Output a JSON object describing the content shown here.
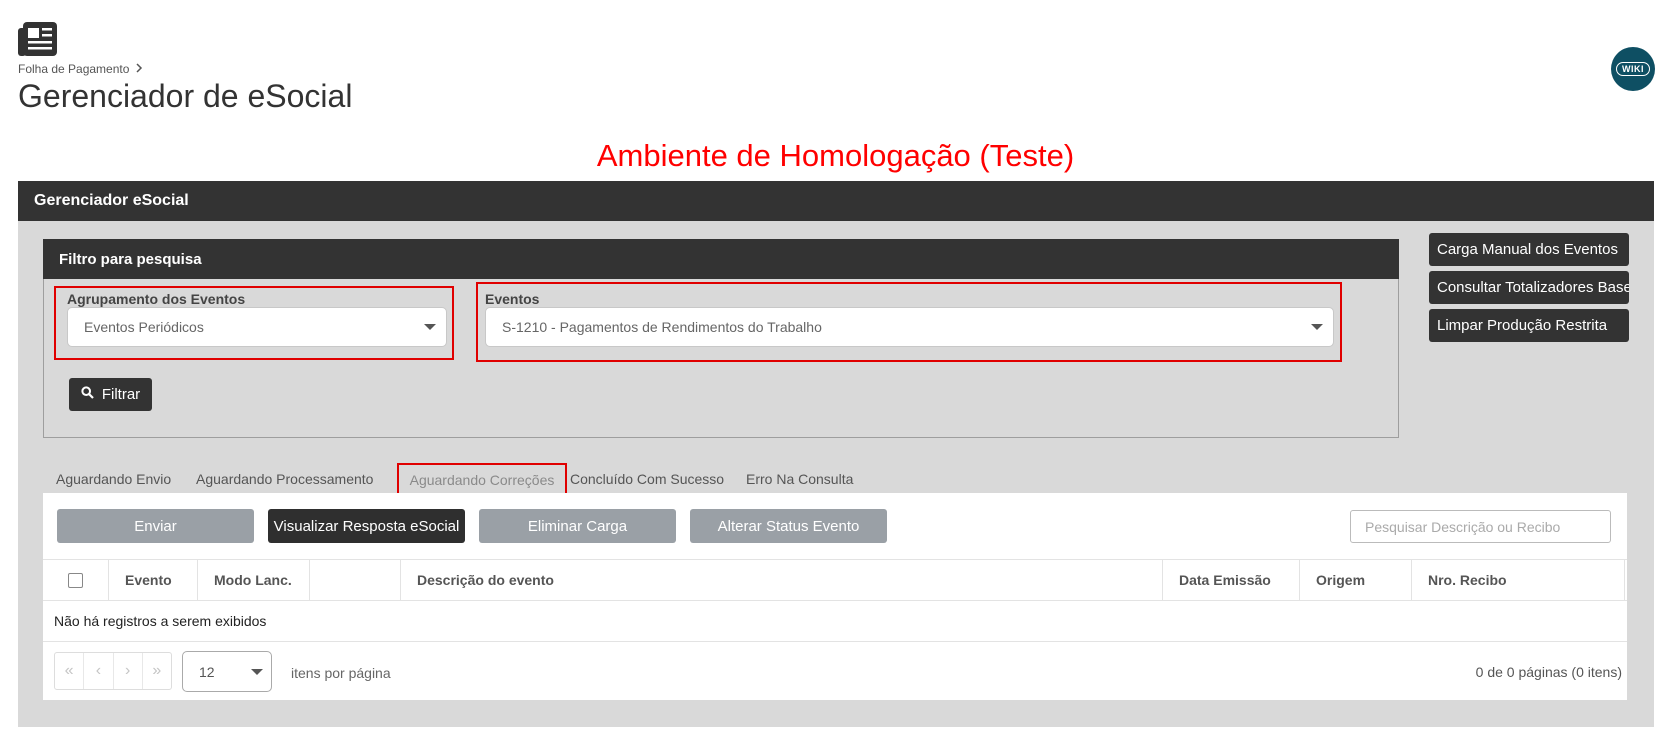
{
  "header": {
    "breadcrumb": "Folha de Pagamento",
    "title": "Gerenciador de eSocial",
    "wiki_label": "WIKI"
  },
  "environment_banner": "Ambiente de Homologação (Teste)",
  "panel": {
    "title": "Gerenciador eSocial"
  },
  "filter": {
    "title": "Filtro para pesquisa",
    "grouping_label": "Agrupamento dos Eventos",
    "grouping_value": "Eventos Periódicos",
    "events_label": "Eventos",
    "events_value": "S-1210 - Pagamentos de Rendimentos do Trabalho",
    "filter_button": "Filtrar"
  },
  "side_buttons": {
    "load": "Carga Manual dos Eventos",
    "totals": "Consultar Totalizadores Base",
    "clear": "Limpar Produção Restrita"
  },
  "tabs": {
    "waiting_send": "Aguardando Envio",
    "waiting_processing": "Aguardando Processamento",
    "waiting_corrections": "Aguardando Correções",
    "success": "Concluído Com Sucesso",
    "error": "Erro Na Consulta"
  },
  "actions": {
    "send": "Enviar",
    "view_response": "Visualizar Resposta eSocial",
    "delete_load": "Eliminar Carga",
    "change_status": "Alterar Status Evento"
  },
  "search": {
    "placeholder": "Pesquisar Descrição ou Recibo"
  },
  "table": {
    "columns": {
      "event": "Evento",
      "mode": "Modo Lanc.",
      "blank": "",
      "description": "Descrição do evento",
      "date": "Data Emissão",
      "origin": "Origem",
      "receipt": "Nro. Recibo"
    },
    "empty_message": "Não há registros a serem exibidos"
  },
  "pagination": {
    "page_size": "12",
    "per_page_label": "itens por página",
    "info": "0 de 0 páginas (0 itens)"
  },
  "colors": {
    "dark_header": "#333333",
    "panel_bg": "#d9d9d9",
    "highlight_red": "#e00000",
    "banner_red": "#ff0000",
    "wiki_bg": "#0e4f63",
    "disabled_button": "#9aa0a6"
  },
  "icons": {
    "app": "newspaper-icon",
    "breadcrumb_separator": "chevron-right-icon",
    "filter": "search-icon",
    "select_toggle": "caret-down-icon"
  }
}
